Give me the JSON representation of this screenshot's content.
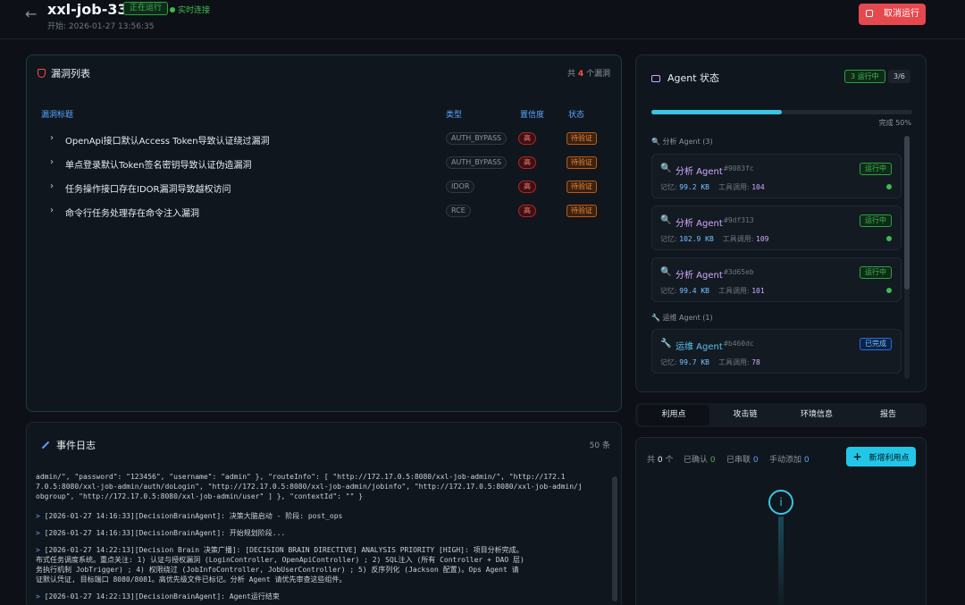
{
  "header": {
    "back_icon": "arrow-left-icon",
    "title": "xxl-job-332",
    "status_badge": "正在运行",
    "live_label": "实时连接",
    "start_time": "开始: 2026-01-27 13:56:35",
    "cancel_label": "取消运行",
    "accent_red": "#e5484d"
  },
  "vulnerabilities": {
    "title": "漏洞列表",
    "count_prefix": "共",
    "count": "4",
    "count_suffix": "个漏洞",
    "columns": {
      "title": "漏洞标题",
      "type": "类型",
      "confidence": "置信度",
      "status": "状态"
    },
    "rows": [
      {
        "title": "OpenApi接口默认Access Token导致认证绕过漏洞",
        "type": "AUTH_BYPASS",
        "severity": "高",
        "status": "待验证"
      },
      {
        "title": "单点登录默认Token签名密钥导致认证伪造漏洞",
        "type": "AUTH_BYPASS",
        "severity": "高",
        "status": "待验证"
      },
      {
        "title": "任务操作接口存在IDOR漏洞导致越权访问",
        "type": "IDOR",
        "severity": "高",
        "status": "待验证"
      },
      {
        "title": "命令行任务处理存在命令注入漏洞",
        "type": "RCE",
        "severity": "高",
        "status": "待验证"
      }
    ]
  },
  "event_log": {
    "title": "事件日志",
    "count": "50 条",
    "lines": [
      {
        "arrow": "",
        "text": "admin/\", \"password\": \"123456\", \"username\": \"admin\" }, \"routeInfo\": [ \"http://172.17.0.5:8080/xxl-job-admin/\", \"http://172.1"
      },
      {
        "arrow": "",
        "text": "7.0.5:8080/xxl-job-admin/auth/doLogin\", \"http://172.17.0.5:8080/xxl-job-admin/jobinfo\", \"http://172.17.0.5:8080/xxl-job-admin/j"
      },
      {
        "arrow": "",
        "text": "obgroup\", \"http://172.17.0.5:8080/xxl-job-admin/user\" ] }, \"contextId\": \"\" }"
      },
      {
        "arrow": ">",
        "text": "[2026-01-27 14:16:33][DecisionBrainAgent]: 决策大脑启动 - 阶段: post_ops"
      },
      {
        "arrow": ">",
        "text": "[2026-01-27 14:16:33][DecisionBrainAgent]: 开始规划阶段..."
      },
      {
        "arrow": ">",
        "text": "[2026-01-27 14:22:13][Decision Brain 决策广播]: [DECISION BRAIN DIRECTIVE] ANALYSIS PRIORITY [HIGH]: 项目分析完成。"
      },
      {
        "arrow": "",
        "text": "布式任务调度系统。重点关注: 1) 认证与授权漏洞 (LoginController, OpenApiController) ; 2) SQL注入 (所有 Controller + DAO 层)"
      },
      {
        "arrow": "",
        "text": "务执行机制 JobTrigger) ; 4) 权限绕过 (JobInfoController, JobUserController) ; 5) 反序列化 (Jackson 配置)。Ops Agent 请"
      },
      {
        "arrow": "",
        "text": "证默认凭证, 目标端口 8080/8081。高优先级文件已标记。分析 Agent 请优先审查这些组件。"
      },
      {
        "arrow": ">",
        "text": "[2026-01-27 14:22:13][DecisionBrainAgent]: Agent运行结束"
      }
    ]
  },
  "agents": {
    "title": "Agent 状态",
    "running_badge": "3 运行中",
    "ratio": "3/6",
    "progress": 0.5,
    "progress_label": "完成 50%",
    "groups": [
      {
        "label": "分析 Agent (3)",
        "icon": "magnifier-icon"
      },
      {
        "label": "运维 Agent (1)",
        "icon": "wrench-icon"
      }
    ],
    "items": [
      {
        "icon": "🔍",
        "icon_name": "magnifier-icon",
        "name": "分析 Agent",
        "id": "#9083fc",
        "status": "运行中",
        "memory_label": "记忆:",
        "memory": "99.2 KB",
        "tools_label": "工具调用:",
        "tools": "104",
        "name_color": "#d2a8ff"
      },
      {
        "icon": "🔍",
        "icon_name": "magnifier-icon",
        "name": "分析 Agent",
        "id": "#9df313",
        "status": "运行中",
        "memory_label": "记忆:",
        "memory": "102.9 KB",
        "tools_label": "工具调用:",
        "tools": "109",
        "name_color": "#d2a8ff"
      },
      {
        "icon": "🔍",
        "icon_name": "magnifier-icon",
        "name": "分析 Agent",
        "id": "#3d65eb",
        "status": "运行中",
        "memory_label": "记忆:",
        "memory": "99.4 KB",
        "tools_label": "工具调用:",
        "tools": "101",
        "name_color": "#d2a8ff"
      },
      {
        "icon": "🔧",
        "icon_name": "wrench-icon",
        "name": "运维 Agent",
        "id": "#b460dc",
        "status": "已完成",
        "memory_label": "记忆:",
        "memory": "99.7 KB",
        "tools_label": "工具调用:",
        "tools": "78",
        "name_color": "#58c4f0"
      }
    ]
  },
  "tabs": [
    "利用点",
    "攻击链",
    "环境信息",
    "报告"
  ],
  "exploits": {
    "total_label": "共",
    "total": "0",
    "total_suffix": "个",
    "confirmed_label": "已确认",
    "confirmed": "0",
    "chained_label": "已串联",
    "chained": "0",
    "manual_label": "手动添加",
    "manual": "0",
    "add_label": "新增利用点",
    "accent": "#22c7e8"
  }
}
